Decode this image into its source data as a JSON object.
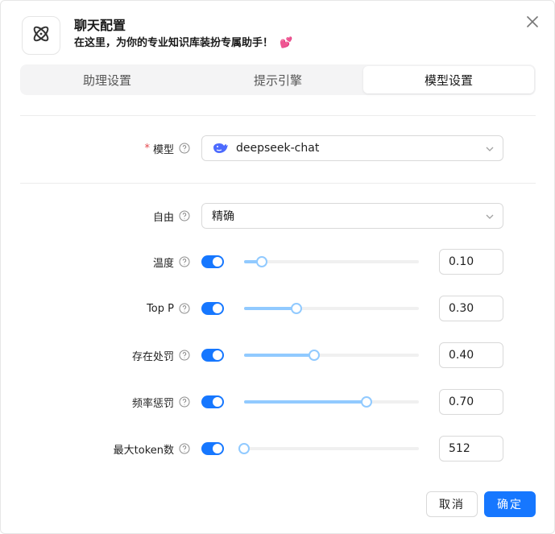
{
  "dialog": {
    "title": "聊天配置",
    "subtitle": "在这里，为你的专业知识库装扮专属助手！",
    "subtitle_emoji": "💕",
    "logo_icon": "atom-icon",
    "close_icon": "close-icon"
  },
  "tabs": [
    {
      "label": "助理设置",
      "active": false
    },
    {
      "label": "提示引擎",
      "active": false
    },
    {
      "label": "模型设置",
      "active": true
    }
  ],
  "model": {
    "required_mark": "*",
    "label": "模型",
    "value": "deepseek-chat",
    "icon": "deepseek-whale-icon"
  },
  "freedom": {
    "label": "自由",
    "value": "精确"
  },
  "params": [
    {
      "label": "温度",
      "enabled": true,
      "slider_fraction": 0.1,
      "value": "0.10"
    },
    {
      "label": "Top P",
      "enabled": true,
      "slider_fraction": 0.3,
      "value": "0.30"
    },
    {
      "label": "存在处罚",
      "enabled": true,
      "slider_fraction": 0.4,
      "value": "0.40"
    },
    {
      "label": "频率惩罚",
      "enabled": true,
      "slider_fraction": 0.7,
      "value": "0.70"
    },
    {
      "label": "最大token数",
      "enabled": true,
      "slider_fraction": 0.0,
      "value": "512"
    }
  ],
  "footer": {
    "cancel_label": "取消",
    "ok_label": "确定"
  },
  "colors": {
    "accent": "#1677ff",
    "slider_track": "#91caff",
    "required": "#e5484d"
  }
}
